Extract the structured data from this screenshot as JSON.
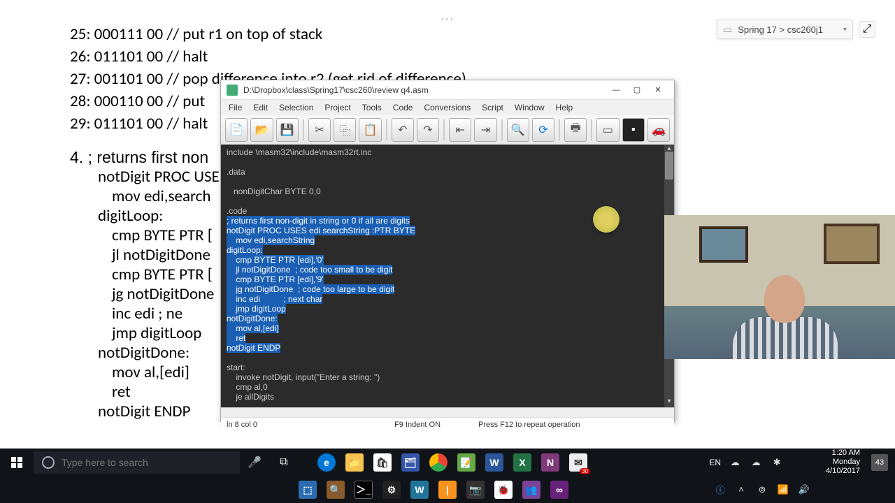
{
  "tab_dots": "...",
  "breadcrumb": {
    "text": "Spring 17 > csc260j1"
  },
  "doc_lines": [
    "25: 000111 00 // put r1 on top of stack",
    "26: 011101 00 // halt",
    "27: 001101 00 // pop difference into r2 (get rid of difference)",
    "28: 000110 00 // put",
    "29: 011101 00 // halt"
  ],
  "q4_lead": "4.    ; returns first non",
  "q4_lines": [
    "notDigit PROC USE",
    "    mov edi,search",
    "digitLoop:",
    "    cmp BYTE PTR [",
    "    jl notDigitDone",
    "    cmp BYTE PTR [",
    "    jg notDigitDone",
    "    inc edi          ; ne",
    "    jmp digitLoop",
    "notDigitDone:",
    "    mov al,[edi]",
    "    ret",
    "notDigit ENDP"
  ],
  "editor": {
    "title": "D:\\Dropbox\\class\\Spring17\\csc260\\review q4.asm",
    "menus": [
      "File",
      "Edit",
      "Selection",
      "Project",
      "Tools",
      "Code",
      "Conversions",
      "Script",
      "Window",
      "Help"
    ],
    "code": {
      "lines": [
        {
          "t": "include \\masm32\\include\\masm32rt.inc",
          "hl": false
        },
        {
          "t": "",
          "hl": false
        },
        {
          "t": ".data",
          "hl": false
        },
        {
          "t": "",
          "hl": false
        },
        {
          "t": "   nonDigitChar BYTE 0,0",
          "hl": false
        },
        {
          "t": "",
          "hl": false
        },
        {
          "t": ".code",
          "hl": false
        },
        {
          "t": "; returns first non-digit in string or 0 if all are digits",
          "hl": true
        },
        {
          "t": "notDigit PROC USES edi searchString :PTR BYTE",
          "hl": true
        },
        {
          "t": "    mov edi,searchString",
          "hl": true
        },
        {
          "t": "digitLoop:",
          "hl": true
        },
        {
          "t": "    cmp BYTE PTR [edi],'0'",
          "hl": true
        },
        {
          "t": "    jl notDigitDone  ; code too small to be digit",
          "hl": true
        },
        {
          "t": "    cmp BYTE PTR [edi],'9'",
          "hl": true
        },
        {
          "t": "    jg notDigitDone  ; code too large to be digit",
          "hl": true
        },
        {
          "t": "    inc edi          ; next char",
          "hl": true
        },
        {
          "t": "    jmp digitLoop",
          "hl": true
        },
        {
          "t": "notDigitDone:",
          "hl": true
        },
        {
          "t": "    mov al,[edi]",
          "hl": true
        },
        {
          "t": "    ret",
          "hl": true
        },
        {
          "t": "notDigit ENDP",
          "hl": true
        },
        {
          "t": "",
          "hl": false
        },
        {
          "t": "start:",
          "hl": false
        },
        {
          "t": "    invoke notDigit, input(\"Enter a string: \")",
          "hl": false
        },
        {
          "t": "    cmp al,0",
          "hl": false
        },
        {
          "t": "    je allDigits",
          "hl": false
        }
      ]
    },
    "status": {
      "pos": "ln 8 col 0",
      "indent": "F9 Indent ON",
      "hint": "Press F12 to repeat operation"
    }
  },
  "search_placeholder": "Type here to search",
  "systray": {
    "lang": "EN",
    "time": "1:20 AM",
    "day": "Monday",
    "date": "4/10/2017",
    "notif_count": "43"
  },
  "mail_badge": "30"
}
